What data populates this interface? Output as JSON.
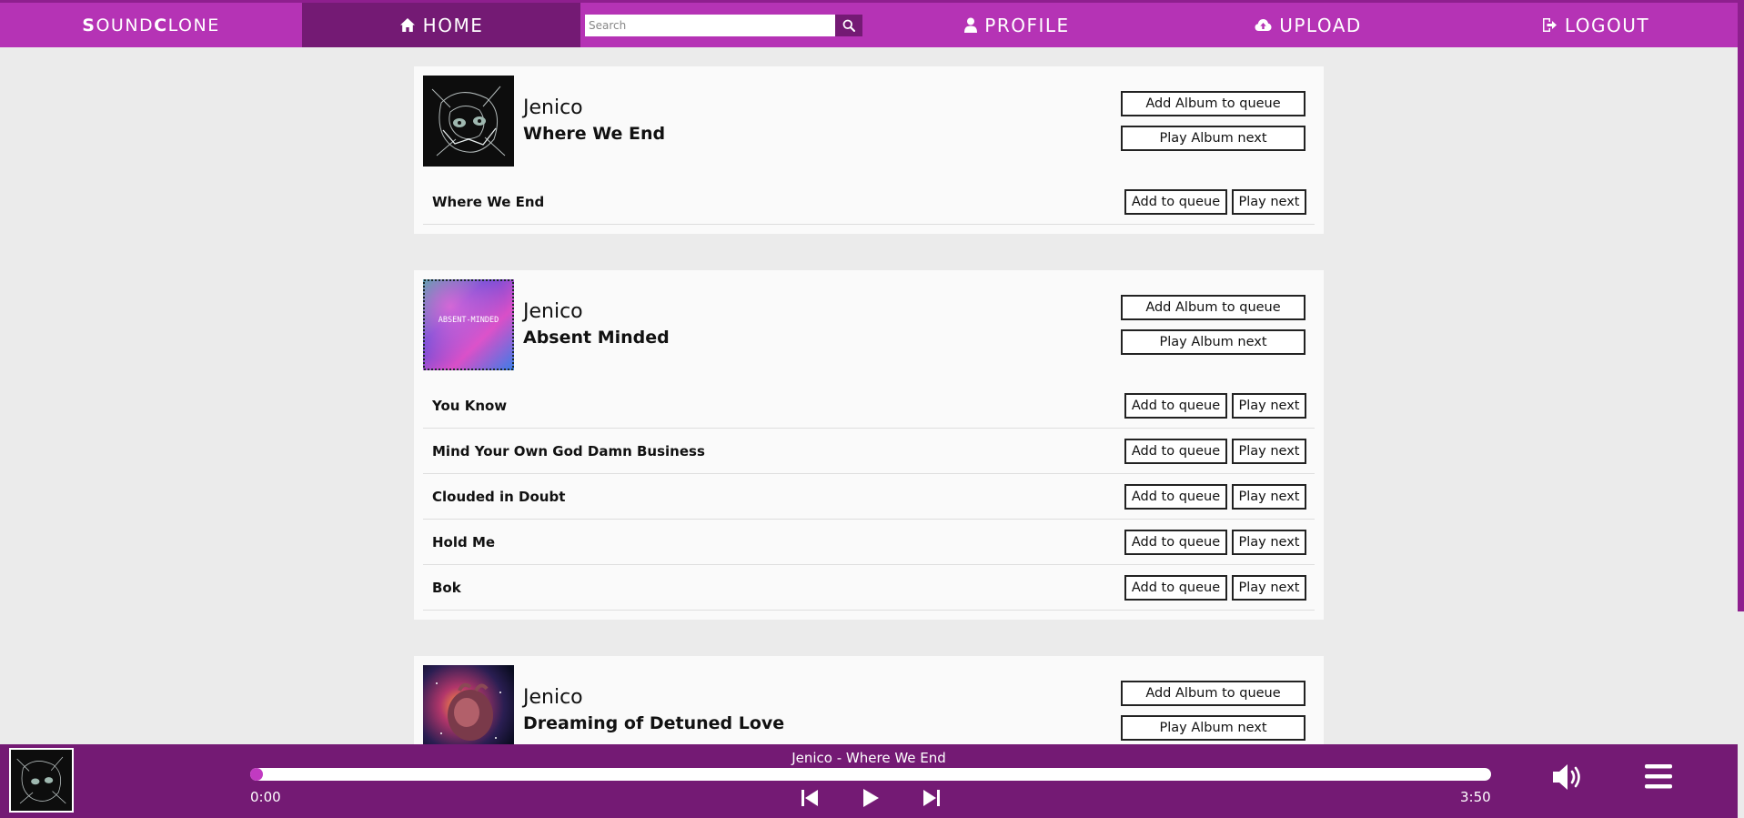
{
  "nav": {
    "logo_s": "S",
    "logo_ound": "OUND",
    "logo_c": "C",
    "logo_lone": "LONE",
    "home": "HOME",
    "profile": "PROFILE",
    "upload": "UPLOAD",
    "logout": "LOGOUT",
    "search_placeholder": "Search",
    "icons": {
      "home": "home-icon",
      "search": "search-icon",
      "profile": "user-icon",
      "upload": "cloud-upload-icon",
      "logout": "sign-out-icon"
    }
  },
  "albums": [
    {
      "artist": "Jenico",
      "title": "Where We End",
      "add_album_label": "Add Album to queue",
      "play_album_label": "Play Album next",
      "tracks": [
        {
          "name": "Where We End",
          "add_label": "Add to queue",
          "next_label": "Play next"
        }
      ]
    },
    {
      "artist": "Jenico",
      "title": "Absent Minded",
      "cover_text": "ABSENT-MINDED",
      "add_album_label": "Add Album to queue",
      "play_album_label": "Play Album next",
      "tracks": [
        {
          "name": "You Know",
          "add_label": "Add to queue",
          "next_label": "Play next"
        },
        {
          "name": "Mind Your Own God Damn Business",
          "add_label": "Add to queue",
          "next_label": "Play next"
        },
        {
          "name": "Clouded in Doubt",
          "add_label": "Add to queue",
          "next_label": "Play next"
        },
        {
          "name": "Hold Me",
          "add_label": "Add to queue",
          "next_label": "Play next"
        },
        {
          "name": "Bok",
          "add_label": "Add to queue",
          "next_label": "Play next"
        }
      ]
    },
    {
      "artist": "Jenico",
      "title": "Dreaming of Detuned Love",
      "add_album_label": "Add Album to queue",
      "play_album_label": "Play Album next",
      "tracks": []
    }
  ],
  "player": {
    "now_playing": "Jenico - Where We End",
    "time_current": "0:00",
    "time_total": "3:50",
    "progress_fraction": 0.0,
    "icons": {
      "prev": "skip-back-icon",
      "play": "play-icon",
      "next": "skip-forward-icon",
      "volume": "volume-icon",
      "queue": "menu-icon"
    }
  },
  "colors": {
    "nav_bg": "#b533b5",
    "nav_active": "#741a74",
    "player_bg": "#741a74",
    "accent": "#c13ac1",
    "page_bg": "#ebebeb",
    "card_bg": "#fafafa"
  }
}
